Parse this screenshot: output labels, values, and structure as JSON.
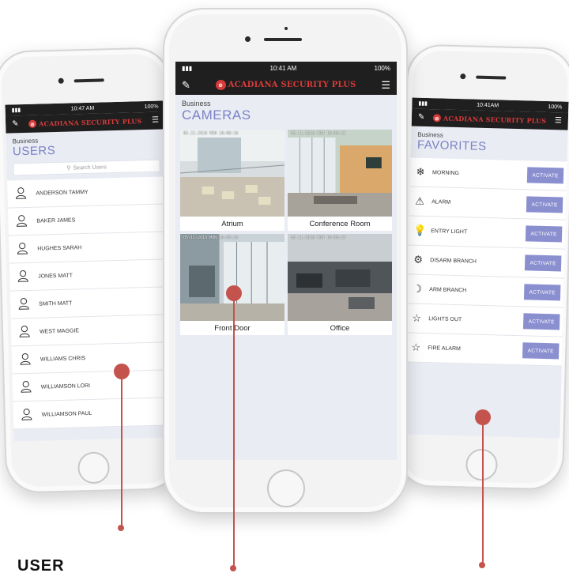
{
  "brand": {
    "name": "ACADIANA SECURITY PLUS",
    "accent": "#d93a3a",
    "header_bg": "#1f1f1f",
    "section_color": "#7b82c7",
    "button_color": "#8a8fcf"
  },
  "left": {
    "status": {
      "time": "10:47 AM",
      "battery": "100%"
    },
    "subtitle": "Business",
    "title": "USERS",
    "search_placeholder": "Search Users",
    "users": [
      "ANDERSON TAMMY",
      "BAKER JAMES",
      "HUGHES SARAH",
      "JONES MATT",
      "SMITH MATT",
      "WEST MAGGIE",
      "WILLIAMS CHRIS",
      "WILLIAMSON LORI",
      "WILLIAMSON PAUL"
    ]
  },
  "center": {
    "status": {
      "time": "10:41 AM",
      "battery": "100%"
    },
    "subtitle": "Business",
    "title": "CAMERAS",
    "cameras": [
      {
        "label": "Atrium",
        "timestamp": "05-11-2018 MON 10:08:10"
      },
      {
        "label": "Conference Room",
        "timestamp": "05-11-2018 MON 10:08:12"
      },
      {
        "label": "Front Door",
        "timestamp": "05-11-2018 MON 10:08:10"
      },
      {
        "label": "Office",
        "timestamp": "05-11-2018 MON 10:08:13"
      }
    ]
  },
  "right": {
    "status": {
      "time": "10:41AM",
      "battery": "100%"
    },
    "subtitle": "Business",
    "title": "FAVORITES",
    "button_label": "ACTIVATE",
    "favorites": [
      {
        "label": "MORNING",
        "icon": "snowflake-icon"
      },
      {
        "label": "ALARM",
        "icon": "alarm-icon"
      },
      {
        "label": "ENTRY LIGHT",
        "icon": "lightbulb-icon"
      },
      {
        "label": "DISARM BRANCH",
        "icon": "gear-icon"
      },
      {
        "label": "ARM BRANCH",
        "icon": "moon-icon"
      },
      {
        "label": "LIGHTS OUT",
        "icon": "star-icon"
      },
      {
        "label": "FIRE ALARM",
        "icon": "star-icon"
      }
    ]
  },
  "captions": {
    "bottom_left": "USER"
  }
}
